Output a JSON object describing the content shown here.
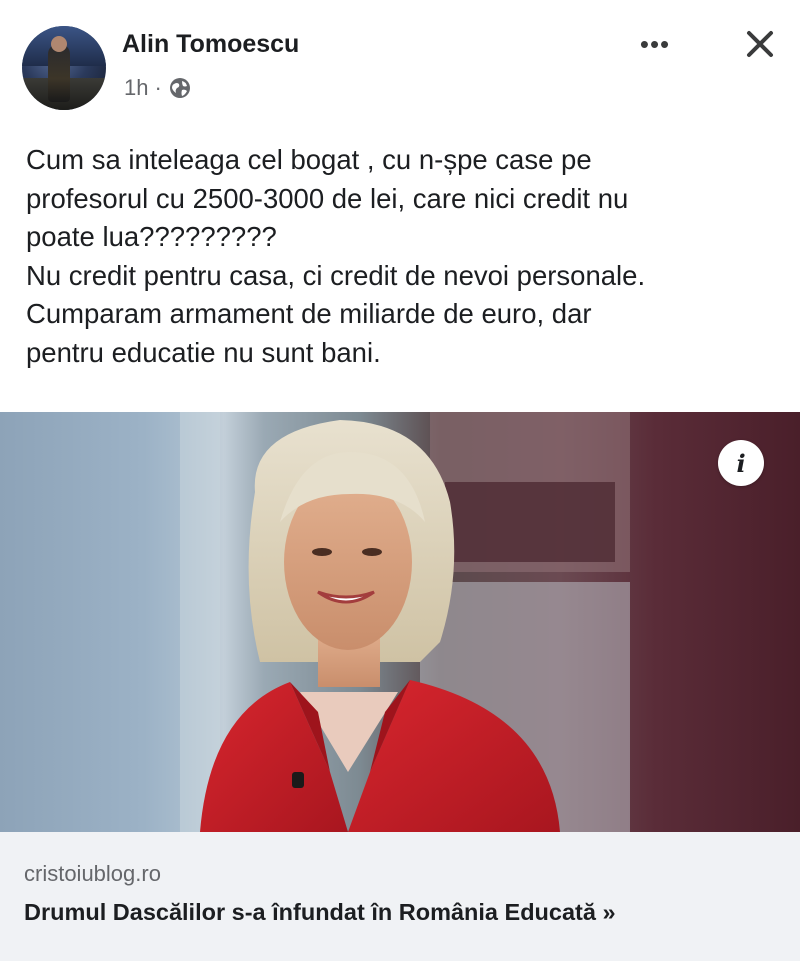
{
  "post": {
    "author": "Alin Tomoescu",
    "time": "1h",
    "separator": "·",
    "privacy_icon": "globe-icon",
    "more_icon": "•••",
    "close_icon": "close-icon",
    "text_lines": [
      "Cum sa inteleaga cel bogat , cu n-șpe case pe",
      "profesorul cu 2500-3000 de lei, care nici credit nu",
      "poate lua?????????",
      "Nu credit pentru casa, ci credit de nevoi personale.",
      "Cumparam armament de miliarde de euro, dar",
      "pentru educatie nu sunt bani."
    ]
  },
  "link_preview": {
    "info_icon": "i",
    "domain": "cristoiublog.ro",
    "title": "Drumul Dascălilor s-a înfundat în România Educată »"
  },
  "colors": {
    "text": "#1c1e21",
    "secondary_text": "#65676b",
    "footer_bg": "#f0f2f5",
    "jacket_red": "#c8202a"
  }
}
